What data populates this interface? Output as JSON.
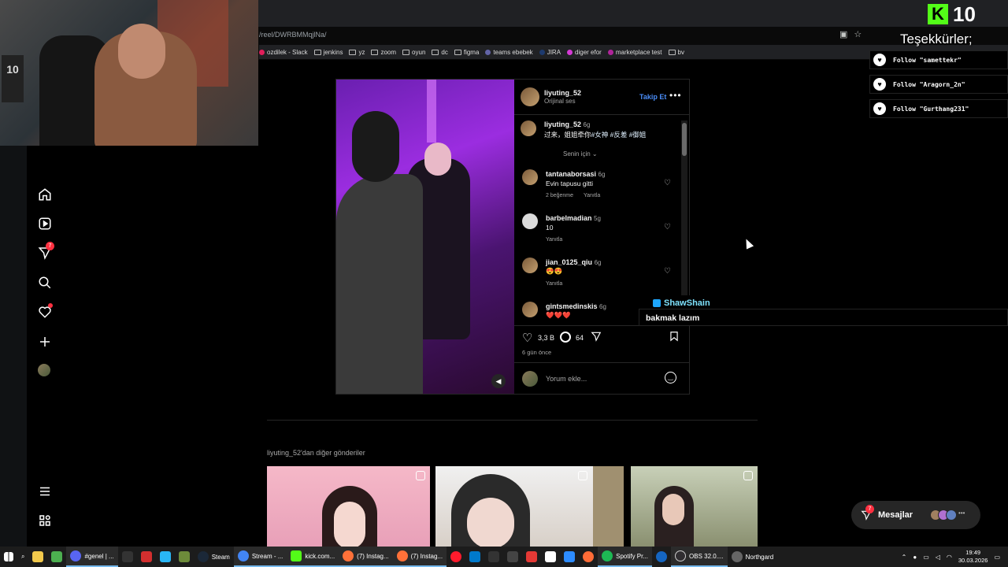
{
  "browser": {
    "url": "/reel/DWRBMMqjlNa/",
    "bookmarks": [
      "ozdilek - Slack",
      "jenkins",
      "yz",
      "zoom",
      "oyun",
      "dc",
      "figma",
      "teams ebebek",
      "JIRA",
      "diger efor",
      "marketplace test",
      "bv"
    ]
  },
  "sidebar": {
    "notification_badge": "7"
  },
  "post": {
    "author": "liyuting_52",
    "audio": "Orijinal ses",
    "follow_label": "Takip Et",
    "caption": {
      "user": "liyuting_52",
      "time": "6g",
      "text": "过来，姐姐牵你",
      "hashtags": "#女神 #反差 #御姐"
    },
    "sort_label": "Senin için",
    "comments": [
      {
        "user": "tantanaborsasi",
        "time": "6g",
        "text": "Evin tapusu gitti",
        "likes": "2 beğenme",
        "reply": "Yanıtla"
      },
      {
        "user": "barbelmadian",
        "time": "5g",
        "text": "10",
        "reply": "Yanıtla"
      },
      {
        "user": "jian_0125_qiu",
        "time": "6g",
        "text": "😍😍",
        "reply": "Yanıtla"
      },
      {
        "user": "gintsmedinskis",
        "time": "6g",
        "text": "❤️❤️❤️"
      }
    ],
    "like_count": "3,3 B",
    "comment_count": "64",
    "posted": "6 gün önce",
    "add_comment_placeholder": "Yorum ekle..."
  },
  "more_posts": {
    "title": "liyuting_52'dan diğer gönderiler"
  },
  "overlay": {
    "kick_count": "10",
    "thanks": "Teşekkürler;",
    "alerts": [
      "Follow \"samettekr\"",
      "Follow \"Aragorn_2n\"",
      "Follow \"Gurthang231\""
    ],
    "chat_user": "ShawShain",
    "chat_message": "bakmak lazım"
  },
  "messages": {
    "label": "Mesajlar",
    "badge": "7"
  },
  "taskbar": {
    "items": [
      "#genel | ...",
      "Steam",
      "Stream - ...",
      "kick.com...",
      "(7) Instag...",
      "(7) Instag...",
      "Spotify Pr...",
      "OBS 32.0....",
      "Northgard"
    ],
    "time": "19:49",
    "date": "30.03.2026"
  }
}
